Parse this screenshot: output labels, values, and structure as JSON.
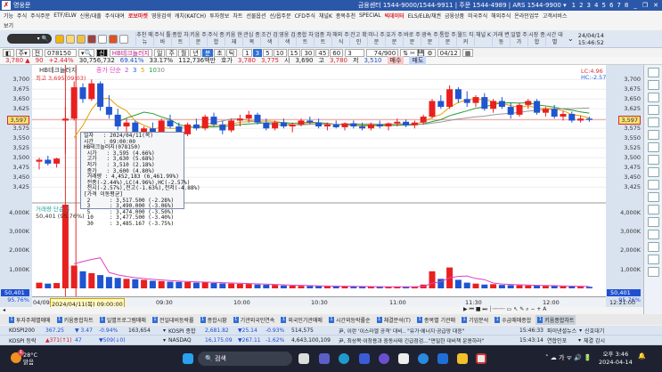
{
  "app": {
    "title": "영웅문",
    "center_info": "금융센터 1544-9000/1544-9911 | 주문 1544-4989 | ARS 1544-9900 ▾",
    "screens": [
      "1",
      "2",
      "3",
      "4",
      "5",
      "6",
      "7",
      "8"
    ]
  },
  "menu": {
    "row1": [
      {
        "label": "기능"
      },
      {
        "label": "주식"
      },
      {
        "label": "주식주문"
      },
      {
        "label": "ETF/ELW"
      },
      {
        "label": "신용/대출"
      },
      {
        "label": "주식대여"
      },
      {
        "label": "로보마켓",
        "red": true
      },
      {
        "label": "영웅검색"
      },
      {
        "label": "캐치(KATCH)"
      },
      {
        "label": "투자정보"
      },
      {
        "label": "차트"
      },
      {
        "label": "선물옵션"
      },
      {
        "label": "선/옵주문"
      },
      {
        "label": "CFD주식"
      },
      {
        "label": "채널K"
      },
      {
        "label": "종목추천"
      },
      {
        "label": "SPECIAL"
      },
      {
        "label": "빅데이터",
        "red": true
      },
      {
        "label": "ELS/ELB/채권"
      },
      {
        "label": "금융상품"
      },
      {
        "label": "미국주식"
      },
      {
        "label": "해외주식"
      },
      {
        "label": "온라인업무"
      },
      {
        "label": "고객서비스"
      }
    ],
    "row2": [
      {
        "label": "보기"
      }
    ]
  },
  "toolbar": {
    "buttons": [
      "추천 메뉴",
      "주식 툴바",
      "종합 차트",
      "키움 주문",
      "주식 종합",
      "키움 현재",
      "관심 종목",
      "조건 검색",
      "영웅 검색",
      "종합 차트",
      "업종 차트",
      "해외 주식",
      "잔고 확인",
      "미니 주문",
      "호가 주문",
      "바로 주문",
      "광속 주문",
      "통합 주문",
      "월드 티커",
      "채널 K",
      "거래 변동",
      "일별 주가",
      "시장 종합",
      "시간 대별"
    ],
    "date": "24/04/14",
    "time": "15:46:52"
  },
  "control": {
    "code": "078150",
    "name": "HB테크놀러지",
    "periods": [
      "일",
      "주",
      "월",
      "년",
      "분",
      "초",
      "틱"
    ],
    "selected_period": "분",
    "intervals": [
      "1",
      "3",
      "5",
      "10",
      "15",
      "30",
      "45",
      "60"
    ],
    "selected_interval": "3",
    "interval_select": "3",
    "count": "74/900",
    "date": "04/12"
  },
  "quote": {
    "price": "3,780 ▲",
    "change": "90",
    "rate": "+2.44%",
    "volume": "30,756,732",
    "vol_ratio": "69.41%",
    "turnover": "33.17%",
    "amount": "112,736백만",
    "hoga_label": "호가",
    "ask": "3,780",
    "bid": "3,775",
    "open_label": "시",
    "open": "3,690",
    "high_label": "고",
    "high": "3,780",
    "low_label": "저",
    "low": "3,510",
    "buy": "매수",
    "sell": "매도"
  },
  "chart_data": {
    "type": "candlestick",
    "legend": {
      "name": "HB테크놀러지",
      "price": "종가",
      "ma_label": "단순",
      "mas": [
        "2",
        "3",
        "5",
        "10",
        "30"
      ],
      "high_note": "최고 3,695(09:03)",
      "volume_label": "거래량",
      "volume_ma": "단순 5",
      "volume_value": "50,401 (95.76%)",
      "lc": "LC:4.96",
      "hc": "HC:-2.57"
    },
    "ylim": [
      3412,
      3712
    ],
    "yticks": [
      3700,
      3675,
      3650,
      3625,
      3600,
      3575,
      3550,
      3525,
      3500,
      3475,
      3450,
      3425
    ],
    "ytick_labels": [
      "3,700",
      "3,675",
      "3,650",
      "3,625",
      "3,600",
      "3,575",
      "3,550",
      "3,525",
      "3,500",
      "3,475",
      "3,450",
      "3,425"
    ],
    "current": "3,597",
    "vticks": [
      "4,000K",
      "3,000K",
      "2,000K",
      "1,000K"
    ],
    "vcurrent": "50,401",
    "vpct": "95.76%",
    "xticks": [
      "04/09",
      "09:30",
      "10:00",
      "10:30",
      "11:00",
      "11:30",
      "12:00"
    ],
    "x_cursor": "2024/04/11(목) 09:00:00",
    "x_end": "12:21:00",
    "candles": [
      [
        3490,
        3500,
        3470,
        3495,
        300
      ],
      [
        3495,
        3505,
        3480,
        3485,
        250
      ],
      [
        3485,
        3500,
        3475,
        3498,
        280
      ],
      [
        3595,
        3630,
        3510,
        3600,
        4452
      ],
      [
        3600,
        3695,
        3595,
        3680,
        1200
      ],
      [
        3680,
        3690,
        3640,
        3650,
        900
      ],
      [
        3650,
        3700,
        3645,
        3690,
        800
      ],
      [
        3690,
        3695,
        3620,
        3630,
        700
      ],
      [
        3630,
        3660,
        3600,
        3610,
        600
      ],
      [
        3610,
        3625,
        3570,
        3580,
        550
      ],
      [
        3580,
        3600,
        3560,
        3590,
        500
      ],
      [
        3590,
        3595,
        3550,
        3560,
        480
      ],
      [
        3560,
        3580,
        3545,
        3575,
        450
      ],
      [
        3575,
        3590,
        3560,
        3565,
        400
      ],
      [
        3565,
        3600,
        3560,
        3595,
        380
      ],
      [
        3595,
        3610,
        3575,
        3580,
        350
      ],
      [
        3580,
        3590,
        3555,
        3560,
        340
      ],
      [
        3560,
        3590,
        3555,
        3585,
        330
      ],
      [
        3585,
        3600,
        3570,
        3575,
        300
      ],
      [
        3575,
        3610,
        3570,
        3605,
        320
      ],
      [
        3605,
        3615,
        3580,
        3585,
        280
      ],
      [
        3585,
        3595,
        3560,
        3570,
        260
      ],
      [
        3570,
        3600,
        3565,
        3595,
        250
      ],
      [
        3595,
        3610,
        3580,
        3600,
        240
      ],
      [
        3600,
        3620,
        3590,
        3610,
        230
      ],
      [
        3610,
        3615,
        3585,
        3590,
        200
      ],
      [
        3590,
        3600,
        3570,
        3575,
        190
      ],
      [
        3575,
        3595,
        3570,
        3590,
        180
      ],
      [
        3590,
        3600,
        3575,
        3580,
        150
      ],
      [
        3580,
        3590,
        3565,
        3585,
        140
      ],
      [
        3585,
        3600,
        3580,
        3595,
        130
      ],
      [
        3595,
        3605,
        3585,
        3590,
        120
      ],
      [
        3590,
        3600,
        3575,
        3580,
        120
      ],
      [
        3580,
        3590,
        3570,
        3585,
        110
      ],
      [
        3585,
        3595,
        3575,
        3578,
        100
      ],
      [
        3578,
        3590,
        3570,
        3588,
        100
      ],
      [
        3588,
        3595,
        3575,
        3580,
        90
      ],
      [
        3580,
        3590,
        3570,
        3575,
        90
      ],
      [
        3575,
        3590,
        3570,
        3585,
        80
      ],
      [
        3585,
        3595,
        3575,
        3580,
        80
      ],
      [
        3580,
        3590,
        3570,
        3588,
        85
      ],
      [
        3588,
        3600,
        3580,
        3592,
        90
      ],
      [
        3592,
        3598,
        3578,
        3583,
        80
      ],
      [
        3583,
        3595,
        3575,
        3590,
        85
      ],
      [
        3590,
        3610,
        3585,
        3605,
        200
      ],
      [
        3605,
        3650,
        3600,
        3645,
        900
      ],
      [
        3645,
        3660,
        3625,
        3630,
        500
      ],
      [
        3630,
        3685,
        3625,
        3675,
        1100
      ],
      [
        3675,
        3680,
        3640,
        3650,
        450
      ],
      [
        3650,
        3670,
        3630,
        3640,
        300
      ],
      [
        3640,
        3660,
        3630,
        3655,
        250
      ],
      [
        3655,
        3665,
        3620,
        3625,
        200
      ],
      [
        3625,
        3650,
        3615,
        3645,
        220
      ],
      [
        3645,
        3655,
        3625,
        3630,
        180
      ],
      [
        3630,
        3640,
        3600,
        3610,
        170
      ],
      [
        3610,
        3640,
        3605,
        3635,
        160
      ],
      [
        3635,
        3650,
        3625,
        3645,
        150
      ],
      [
        3645,
        3650,
        3610,
        3615,
        140
      ],
      [
        3615,
        3630,
        3605,
        3625,
        130
      ],
      [
        3625,
        3635,
        3600,
        3605,
        120
      ],
      [
        3605,
        3620,
        3595,
        3612,
        110
      ],
      [
        3612,
        3618,
        3590,
        3595,
        100
      ],
      [
        3595,
        3608,
        3590,
        3600,
        90
      ],
      [
        3600,
        3605,
        3592,
        3597,
        80
      ]
    ],
    "colors": {
      "up": "#e8201f",
      "down": "#1f55d0",
      "ma5": "#e8a000",
      "ma10": "#2a9a3a",
      "ma20": "#999999"
    }
  },
  "tooltip": {
    "lines": [
      "일자   : 2024/04/11(목)",
      "시간   : 09:00:00",
      "HB테크놀러지(078150)",
      " 시가   : 3,595 (4.66%)",
      " 고가   : 3,630 (5.68%)",
      " 저가   : 3,510 (2.18%)",
      " 종가   : 3,600 (4.80%)",
      " 거래량 : 4,452,183 (6,461.99%)",
      " 전종(-2.44%),LC(4.96%),HC(-2.57%)",
      " 전시(-2.57%),전고(-1.63%),전저(-4.88%)",
      "[가격 이동평균]",
      " 2      : 3,517.500 (-2.28%)",
      " 3      : 3,490.000 (-3.06%)",
      " 5      : 3,474.000 (-3.50%)",
      " 10     : 3,477.500 (-3.40%)",
      " 30     : 3,485.167 (-3.75%)"
    ]
  },
  "tabs": [
    {
      "label": "투자주체별매매"
    },
    {
      "label": "키움종합차트"
    },
    {
      "label": "일별프로그램매매"
    },
    {
      "label": "전일대비등락률"
    },
    {
      "label": "종합시황"
    },
    {
      "label": "기관외국인연속"
    },
    {
      "label": "외국인기관매매"
    },
    {
      "label": "시간외등락률순"
    },
    {
      "label": "체결분석(T)"
    },
    {
      "label": "종목별 기관매"
    },
    {
      "label": "기업분석"
    },
    {
      "label": "수급매매종합"
    },
    {
      "label": "키움종합차트",
      "active": true
    }
  ],
  "index_rows": [
    {
      "name1": "KOSPI200",
      "v1": "367.25",
      "c1": "▼ 3.47",
      "r1": "-0.94%",
      "x1": "163,654",
      "name2": "KOSPI 종합",
      "v2": "2,681.82",
      "c2": "▼25.14",
      "r2": "-0.93%",
      "x2": "514,575",
      "news": "尹, 이란 '이스라엘 공격' 대비.. \"유가·에너지·공급망 대응\"",
      "time": "15:46:33",
      "source": "파이낸셜뉴스",
      "extra": "신호대기"
    },
    {
      "name1": "KOSPI 등락",
      "v1": "▲371(↑1)",
      "c1": "47",
      "r1": "▼509(↓0)",
      "x1": "",
      "name2": "NASDAQ",
      "v2": "16,175.09",
      "c2": "▼267.11",
      "r2": "-1.62%",
      "x2": "4,643,100,109",
      "news": "尹, 최상목·이창용과 중동사태 긴급점검…\"면밀한 대비책 운용하라\"",
      "time": "15:43:14",
      "source": "연합인포",
      "extra": "체결 감시"
    }
  ],
  "taskbar": {
    "temp": "28°C",
    "weather": "맑음",
    "badge": "1",
    "search": "검색",
    "time": "오후 3:46",
    "date": "2024-04-14",
    "ime": "가"
  }
}
